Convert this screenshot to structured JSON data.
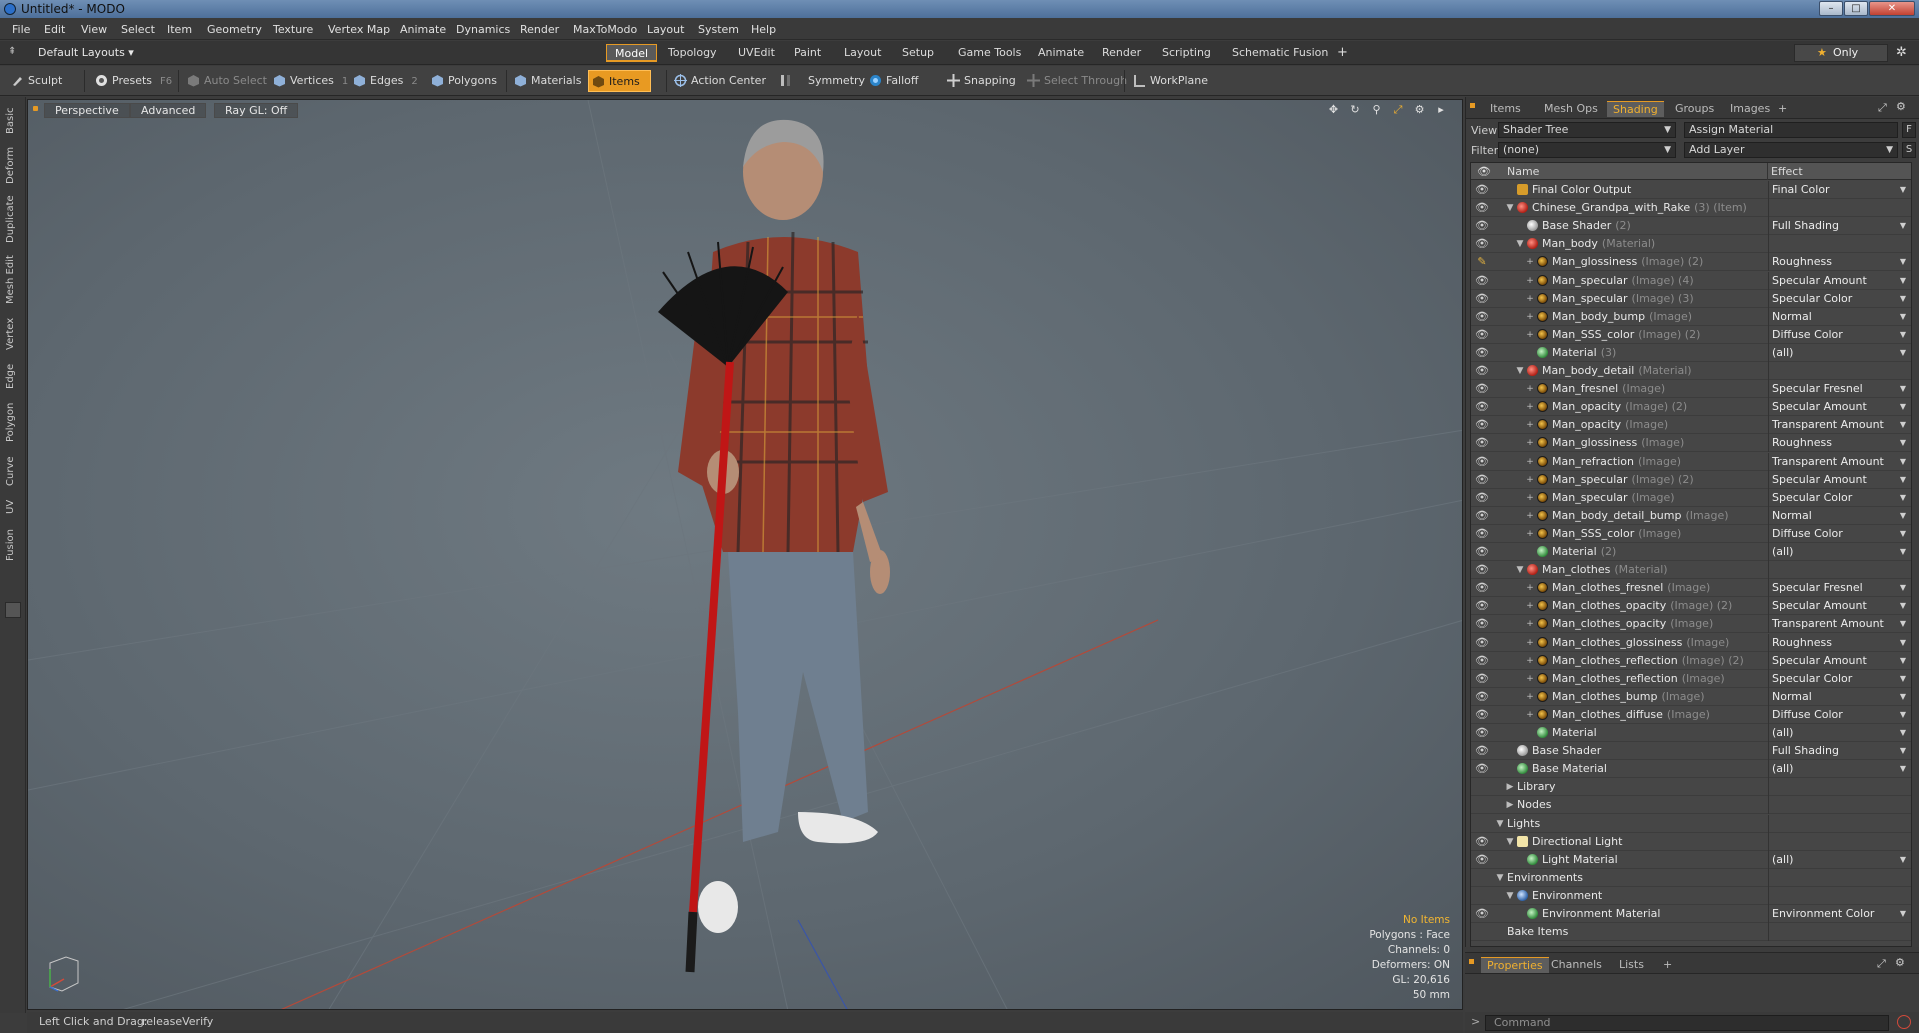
{
  "window": {
    "title": "Untitled* - MODO",
    "min": "–",
    "max": "□",
    "close": "✕"
  },
  "menu": [
    "File",
    "Edit",
    "View",
    "Select",
    "Item",
    "Geometry",
    "Texture",
    "Vertex Map",
    "Animate",
    "Dynamics",
    "Render",
    "MaxToModo",
    "Layout",
    "System",
    "Help"
  ],
  "layoutbar": {
    "layout_select": "Default Layouts ▾",
    "tabs": [
      "Model",
      "Topology",
      "UVEdit",
      "Paint",
      "Layout",
      "Setup",
      "Game Tools",
      "Animate",
      "Render",
      "Scripting",
      "Schematic Fusion",
      "+"
    ],
    "active_tab": "Model",
    "only_label": "Only"
  },
  "toolbar": {
    "sculpt": "Sculpt",
    "presets": "Presets",
    "presets_key": "F6",
    "auto_select": "Auto Select",
    "vertices": "Vertices",
    "vertices_key": "1",
    "edges": "Edges",
    "edges_key": "2",
    "polygons": "Polygons",
    "materials": "Materials",
    "items": "Items",
    "action_center": "Action Center",
    "symmetry": "Symmetry",
    "falloff": "Falloff",
    "snapping": "Snapping",
    "select_through": "Select Through",
    "workplane": "WorkPlane"
  },
  "left_tabs": [
    "Basic",
    "Deform",
    "Duplicate",
    "Mesh Edit",
    "Vertex",
    "Edge",
    "Polygon",
    "Curve",
    "UV",
    "Fusion"
  ],
  "viewport": {
    "buttons": [
      "Perspective",
      "Advanced",
      "Ray GL: Off"
    ],
    "stats": {
      "items": "No Items",
      "polygons": "Polygons : Face",
      "channels": "Channels: 0",
      "deformers": "Deformers: ON",
      "gl": "GL: 20,616",
      "focal": "50 mm"
    }
  },
  "statusbar": {
    "hint_label": "Left Click and Drag:",
    "hint_action": "releaseVerify"
  },
  "right_panel": {
    "tabs": [
      "Items",
      "Mesh Ops",
      "Shading",
      "Groups",
      "Images",
      "+"
    ],
    "active_tab": "Shading",
    "view_label": "View",
    "view_value": "Shader Tree",
    "assign_material": "Assign Material",
    "f_btn": "F",
    "filter_label": "Filter",
    "filter_value": "(none)",
    "add_layer": "Add Layer",
    "s_btn": "S",
    "columns": {
      "name": "Name",
      "effect": "Effect"
    },
    "rows": [
      {
        "level": 1,
        "tog": "",
        "icon": "out",
        "name": "Final Color Output",
        "sub": "",
        "effect": "Final Color",
        "eye": true
      },
      {
        "level": 1,
        "tog": "▼",
        "icon": "mat-red",
        "name": "Chinese_Grandpa_with_Rake",
        "sub": "(3) (Item)",
        "effect": "",
        "eye": true
      },
      {
        "level": 2,
        "tog": "",
        "icon": "shader",
        "name": "Base Shader",
        "sub": "(2)",
        "effect": "Full Shading",
        "eye": true
      },
      {
        "level": 2,
        "tog": "▼",
        "icon": "mat-red",
        "name": "Man_body",
        "sub": "(Material)",
        "effect": "",
        "eye": true
      },
      {
        "level": 3,
        "tog": "+",
        "icon": "img",
        "name": "Man_glossiness",
        "sub": "(Image) (2)",
        "effect": "Roughness",
        "eye": true,
        "brush": true
      },
      {
        "level": 3,
        "tog": "+",
        "icon": "img",
        "name": "Man_specular",
        "sub": "(Image) (4)",
        "effect": "Specular Amount",
        "eye": true
      },
      {
        "level": 3,
        "tog": "+",
        "icon": "img",
        "name": "Man_specular",
        "sub": "(Image) (3)",
        "effect": "Specular Color",
        "eye": true
      },
      {
        "level": 3,
        "tog": "+",
        "icon": "img",
        "name": "Man_body_bump",
        "sub": "(Image)",
        "effect": "Normal",
        "eye": true
      },
      {
        "level": 3,
        "tog": "+",
        "icon": "img",
        "name": "Man_SSS_color",
        "sub": "(Image) (2)",
        "effect": "Diffuse Color",
        "eye": true
      },
      {
        "level": 3,
        "tog": "",
        "icon": "mat-green",
        "name": "Material",
        "sub": "(3)",
        "effect": "(all)",
        "eye": true
      },
      {
        "level": 2,
        "tog": "▼",
        "icon": "mat-red",
        "name": "Man_body_detail",
        "sub": "(Material)",
        "effect": "",
        "eye": true
      },
      {
        "level": 3,
        "tog": "+",
        "icon": "img",
        "name": "Man_fresnel",
        "sub": "(Image)",
        "effect": "Specular Fresnel",
        "eye": true
      },
      {
        "level": 3,
        "tog": "+",
        "icon": "img",
        "name": "Man_opacity",
        "sub": "(Image) (2)",
        "effect": "Specular Amount",
        "eye": true
      },
      {
        "level": 3,
        "tog": "+",
        "icon": "img",
        "name": "Man_opacity",
        "sub": "(Image)",
        "effect": "Transparent Amount",
        "eye": true
      },
      {
        "level": 3,
        "tog": "+",
        "icon": "img",
        "name": "Man_glossiness",
        "sub": "(Image)",
        "effect": "Roughness",
        "eye": true
      },
      {
        "level": 3,
        "tog": "+",
        "icon": "img",
        "name": "Man_refraction",
        "sub": "(Image)",
        "effect": "Transparent Amount",
        "eye": true
      },
      {
        "level": 3,
        "tog": "+",
        "icon": "img",
        "name": "Man_specular",
        "sub": "(Image) (2)",
        "effect": "Specular Amount",
        "eye": true
      },
      {
        "level": 3,
        "tog": "+",
        "icon": "img",
        "name": "Man_specular",
        "sub": "(Image)",
        "effect": "Specular Color",
        "eye": true
      },
      {
        "level": 3,
        "tog": "+",
        "icon": "img",
        "name": "Man_body_detail_bump",
        "sub": "(Image)",
        "effect": "Normal",
        "eye": true
      },
      {
        "level": 3,
        "tog": "+",
        "icon": "img",
        "name": "Man_SSS_color",
        "sub": "(Image)",
        "effect": "Diffuse Color",
        "eye": true
      },
      {
        "level": 3,
        "tog": "",
        "icon": "mat-green",
        "name": "Material",
        "sub": "(2)",
        "effect": "(all)",
        "eye": true
      },
      {
        "level": 2,
        "tog": "▼",
        "icon": "mat-red",
        "name": "Man_clothes",
        "sub": "(Material)",
        "effect": "",
        "eye": true
      },
      {
        "level": 3,
        "tog": "+",
        "icon": "img",
        "name": "Man_clothes_fresnel",
        "sub": "(Image)",
        "effect": "Specular Fresnel",
        "eye": true
      },
      {
        "level": 3,
        "tog": "+",
        "icon": "img",
        "name": "Man_clothes_opacity",
        "sub": "(Image) (2)",
        "effect": "Specular Amount",
        "eye": true
      },
      {
        "level": 3,
        "tog": "+",
        "icon": "img",
        "name": "Man_clothes_opacity",
        "sub": "(Image)",
        "effect": "Transparent Amount",
        "eye": true
      },
      {
        "level": 3,
        "tog": "+",
        "icon": "img",
        "name": "Man_clothes_glossiness",
        "sub": "(Image)",
        "effect": "Roughness",
        "eye": true
      },
      {
        "level": 3,
        "tog": "+",
        "icon": "img",
        "name": "Man_clothes_reflection",
        "sub": "(Image) (2)",
        "effect": "Specular Amount",
        "eye": true
      },
      {
        "level": 3,
        "tog": "+",
        "icon": "img",
        "name": "Man_clothes_reflection",
        "sub": "(Image)",
        "effect": "Specular Color",
        "eye": true
      },
      {
        "level": 3,
        "tog": "+",
        "icon": "img",
        "name": "Man_clothes_bump",
        "sub": "(Image)",
        "effect": "Normal",
        "eye": true
      },
      {
        "level": 3,
        "tog": "+",
        "icon": "img",
        "name": "Man_clothes_diffuse",
        "sub": "(Image)",
        "effect": "Diffuse Color",
        "eye": true
      },
      {
        "level": 3,
        "tog": "",
        "icon": "mat-green",
        "name": "Material",
        "sub": "",
        "effect": "(all)",
        "eye": true
      },
      {
        "level": 1,
        "tog": "",
        "icon": "shader",
        "name": "Base Shader",
        "sub": "",
        "effect": "Full Shading",
        "eye": true
      },
      {
        "level": 1,
        "tog": "",
        "icon": "mat-green",
        "name": "Base Material",
        "sub": "",
        "effect": "(all)",
        "eye": true
      },
      {
        "level": 1,
        "tog": "▶",
        "icon": "",
        "name": "Library",
        "sub": "",
        "effect": "",
        "eye": false
      },
      {
        "level": 1,
        "tog": "▶",
        "icon": "",
        "name": "Nodes",
        "sub": "",
        "effect": "",
        "eye": false
      },
      {
        "level": 0,
        "tog": "▼",
        "icon": "",
        "name": "Lights",
        "sub": "",
        "effect": "",
        "eye": false
      },
      {
        "level": 1,
        "tog": "▼",
        "icon": "light",
        "name": "Directional Light",
        "sub": "",
        "effect": "",
        "eye": true
      },
      {
        "level": 2,
        "tog": "",
        "icon": "mat-green",
        "name": "Light Material",
        "sub": "",
        "effect": "(all)",
        "eye": true
      },
      {
        "level": 0,
        "tog": "▼",
        "icon": "",
        "name": "Environments",
        "sub": "",
        "effect": "",
        "eye": false
      },
      {
        "level": 1,
        "tog": "▼",
        "icon": "env",
        "name": "Environment",
        "sub": "",
        "effect": "",
        "eye": false
      },
      {
        "level": 2,
        "tog": "",
        "icon": "mat-green",
        "name": "Environment Material",
        "sub": "",
        "effect": "Environment Color",
        "eye": true
      },
      {
        "level": 0,
        "tog": "",
        "icon": "",
        "name": "Bake Items",
        "sub": "",
        "effect": "",
        "eye": false
      }
    ],
    "bottom_tabs": [
      "Properties",
      "Channels",
      "Lists",
      "+"
    ],
    "bottom_active": "Properties",
    "command_placeholder": "Command"
  },
  "colors": {
    "accent": "#e69a24",
    "viewport_bg": "#5d676f",
    "panel_bg": "#3d3d3d"
  }
}
